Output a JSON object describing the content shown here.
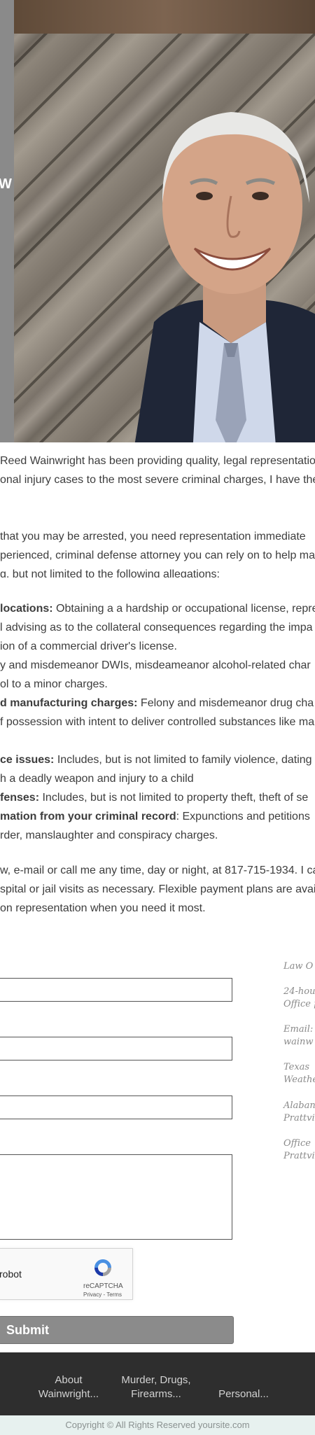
{
  "hero": {
    "side_letter": "W"
  },
  "intro": {
    "lines": [
      "Reed Wainwright has been providing quality, legal representatio",
      "onal injury cases to the most severe criminal charges, I have the",
      "",
      " that you may be arrested, you need representation immediate",
      "perienced, criminal defense attorney you can rely on to help ma",
      "g, but not limited to the following allegations:"
    ]
  },
  "allegations": [
    {
      "bold": "locations:",
      "text": " Obtaining a a hardship or occupational license, repre"
    },
    {
      "bold": "",
      "text": "l advising as to the collateral consequences regarding the impa"
    },
    {
      "bold": "",
      "text": "ion of a commercial driver's license."
    },
    {
      "bold": "",
      "text": "y and misdemeanor DWIs, misdeameanor alcohol-related char"
    },
    {
      "bold": "",
      "text": "ol to a minor charges."
    },
    {
      "bold": "d manufacturing charges:",
      "text": " Felony and misdemeanor drug cha"
    },
    {
      "bold": "",
      "text": "f possession with intent to deliver controlled substances like ma"
    },
    {
      "bold": "",
      "text": ""
    },
    {
      "bold": "ce issues:",
      "text": " Includes, but is not limited to family violence, dating v"
    },
    {
      "bold": "",
      "text": "h a deadly weapon and injury to a child"
    },
    {
      "bold": "fenses:",
      "text": " Includes, but is not limited to property theft, theft of se"
    },
    {
      "bold": "mation from your criminal record",
      "text": ": Expunctions and petitions"
    },
    {
      "bold": "",
      "text": "rder, manslaughter and conspiracy charges."
    }
  ],
  "closing": {
    "lines": [
      "w, e-mail or call me any time, day or night, at 817-715-1934. I ca",
      "spital or jail visits as necessary. Flexible payment plans are avail",
      "on representation when you need it most."
    ]
  },
  "form": {
    "recaptcha": {
      "label": "robot",
      "brand": "reCAPTCHA",
      "terms": "Privacy - Terms"
    },
    "submit_label": "Submit"
  },
  "contact": {
    "items": [
      [
        "Law O"
      ],
      [
        "24-hou",
        "Office p"
      ],
      [
        "Email:",
        "wainw"
      ],
      [
        "Texas ",
        "Weathe"
      ],
      [
        "Alaban",
        "Prattvi"
      ],
      [
        "Office ",
        "Prattvi"
      ]
    ]
  },
  "footer": {
    "nav": [
      {
        "line1": "About",
        "line2": "Wainwright..."
      },
      {
        "line1": "Murder, Drugs,",
        "line2": "Firearms..."
      },
      {
        "line1": "",
        "line2": "Personal..."
      }
    ],
    "copyright": "Copyright © All Rights Reserved yoursite.com"
  },
  "colors": {
    "footer_bg": "#2e2e2e",
    "copyright_bg": "#e7f1ef",
    "submit_bg": "#8b8b8b"
  }
}
